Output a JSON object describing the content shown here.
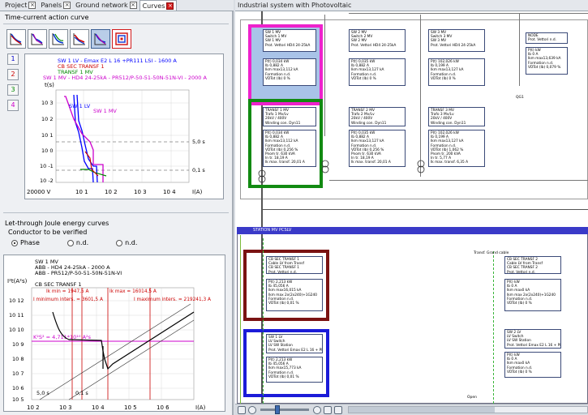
{
  "tabs": [
    {
      "label": "Project",
      "active": false
    },
    {
      "label": "Panels",
      "active": false
    },
    {
      "label": "Ground network",
      "active": false
    },
    {
      "label": "Curves",
      "active": true
    }
  ],
  "canvas_title": "Industrial system with Photovoltaic",
  "time_current": {
    "section_title": "Time-current action curve",
    "curve_buttons": [
      "1",
      "2",
      "3",
      "4"
    ],
    "legend": [
      {
        "text": "SW 1 LV - Emax E2 L 16 +PR111 LSI - 1600 A",
        "color": "#0000ff"
      },
      {
        "text": "CB SEC TRANSF 1",
        "color": "#cc0000"
      },
      {
        "text": "TRANSF 1 MV",
        "color": "#008800"
      },
      {
        "text": "SW 1 MV - HD4 24-25kA - PR512/P-50-51-50N-51N-VI - 2000 A",
        "color": "#cc00cc"
      }
    ],
    "y_label": "t(s)",
    "y_ticks": [
      "10 3",
      "10 2",
      "10 1",
      "10 0",
      "10 -1",
      "10 -2"
    ],
    "x_ticks": [
      "20000 V",
      "10 1",
      "10 2",
      "10 3",
      "10 4"
    ],
    "x_label": "I(A)",
    "ref_lines": [
      "5,0 s",
      "0,1 s"
    ],
    "curve_labels": [
      "SW 1 LV",
      "SW 1 MV"
    ]
  },
  "let_through": {
    "section_title": "Let-through Joule energy curves",
    "conductor_label": "Conductor to be verified",
    "radios": [
      {
        "label": "Phase",
        "on": true
      },
      {
        "label": "n.d.",
        "on": false
      },
      {
        "label": "n.d.",
        "on": false
      }
    ],
    "legend": [
      "SW 1 MV",
      "ABB - HD4 24-25kA - 2000 A",
      "ABB - PR512/P-50-51-50N-51N-VI",
      "CB SEC TRANSF 1"
    ],
    "y_label": "I²t(A²s)",
    "annotations": {
      "ik_min": "Ik min = 1947,5 A",
      "ik_max": "Ik max = 16014,5 A",
      "i_min_inters": "I minimum inters. = 3601,5 A",
      "i_max_inters": "I maximum inters. = 219241,3 A",
      "k2s2": "K²S² = 4,711*10¹⁰ A²s",
      "t5": "5,0 s",
      "t01": "0,1 s"
    },
    "y_ticks": [
      "10 12",
      "10 11",
      "10 10",
      "10 9",
      "10 8",
      "10 7",
      "10 6",
      "10 5"
    ],
    "x_ticks": [
      "10 2",
      "10 3",
      "10 4",
      "10 5",
      "10 6"
    ],
    "x_label": "I(A)"
  },
  "diagram": {
    "station_title": "STATION MV PCSLV",
    "boxes_top": [
      {
        "text": "SW 1 MV\nSwitch 1 MV\nSW 1 MV\nProt. Vettori HD4 24-25kA"
      },
      {
        "text": "SW 2 MV\nSwitch 2 MV\nSW 2 MV\nProt. Vettori HD4 24-25kA"
      },
      {
        "text": "SW 3 MV\nSwitch 3 MV\nSW 3 MV\nProt. Vettori HD4 24-25kA"
      },
      {
        "text": "NODE\nProt. Vettori n.d."
      }
    ],
    "boxes_mid": [
      {
        "text": "P(t) 0,034 kW\nIb 0,882 A\nIkm max13,112 kA\nFormation n.d.\nVDTot (Ib) 0 %"
      },
      {
        "text": "P(t) 0,035 kW\nIb 0,882 A\nIkm max13,127 kA\nFormation n.d.\nVDTot (Ib) 0 %"
      },
      {
        "text": "P(t) 102,026 kW\nIb 0,199 A\nIkm max13,127 kA\nFormation n.d.\nVDTot (Ib) 0 %"
      },
      {
        "text": "P(t) kW\nIb 0 A\nIkm max13,639 kA\nFormation n.d.\nVDTot (Ib) 0,079 %"
      }
    ],
    "boxes_transf": [
      {
        "text": "TRANSF 1 MV\nTrafo 1 Mv/Lv\n20kV / 400V\nWinding con. Dyn11"
      },
      {
        "text": "TRANSF 2 MV\nTrafo 2 Mv/Lv\n20kV / 400V\nWinding con. Dyn11"
      },
      {
        "text": "TRANSF 3 MV\nTrafo 3 Mv/Lv\n20kV / 400V\nWinding con. Dyn11"
      }
    ],
    "boxes_transf_data": [
      {
        "text": "P(t) 0,034 kW\nIb 0,882 A\nIkm max13,112 kA\nFormation n.d.\nVDTot (Ib) 0,256 %\nPnom tr. 630 kVA\nIn tr. 18,19 A\nIk max. transf. 20,01 A"
      },
      {
        "text": "P(t) 0,035 kW\nIb 0,882 A\nIkm max13,127 kA\nFormation n.d.\nVDTot (Ib) 0,256 %\nPnom tr. 630 kVA\nIn tr. 18,19 A\nIk max. transf. 20,01 A"
      },
      {
        "text": "P(t) 102,026 kW\nIb 0,199 A\nIkm max13,127 kA\nFormation n.d.\nVDTot (Ib) 1,062 %\nPnom tr. 200 kVA\nIn tr. 5,77 A\nIk max. transf. 6,35 A"
      }
    ],
    "boxes_station": [
      {
        "text": "CB SEC TRANSF 1\nCable LV from Transf\nCB SEC TRANSF 1\nProt. Vettori n.d."
      },
      {
        "text": "CB SEC TRANSF 2\nCable LV from Transf\nCB SEC TRANSF 2\nProt. Vettori n.d."
      },
      {
        "text": "P(t) 2,213 kW\nIb 45,056 A\nIkm max16,015 kA\nIkm max 2x(2x240)+1G240\nFormation n.d.\nVDTot (Ib) 0,01 %"
      },
      {
        "text": "P(t) kW\nIb 0 A\nIkm max0 kA\nIkm max 2x(2x240)+1G240\nFormation n.d.\nVDTot (Ib) 0 %"
      },
      {
        "text": "SW 1 LV\nLV Switch\nLV SW Station\nProt. Vettori Emax E2 L 16 + PR111 LSI"
      },
      {
        "text": "SW 2 LV\nLV Switch\nLV SW Station\nProt. Vettori Emax E2 L 16 + PR111 LSI"
      },
      {
        "text": "P(t) 2,213 kW\nIb 45,056 A\nIkm max15,773 kA\nFormation n.d.\nVDTot (Ib) 0,01 %"
      },
      {
        "text": "P(t) kW\nIb 0 A\nIkm max0 kA\nFormation n.d.\nVDTot (Ib) 0 %"
      }
    ],
    "small_labels": [
      "QG1",
      "Transf. Grand cable",
      "Transf. Grand cable",
      "Open"
    ]
  }
}
